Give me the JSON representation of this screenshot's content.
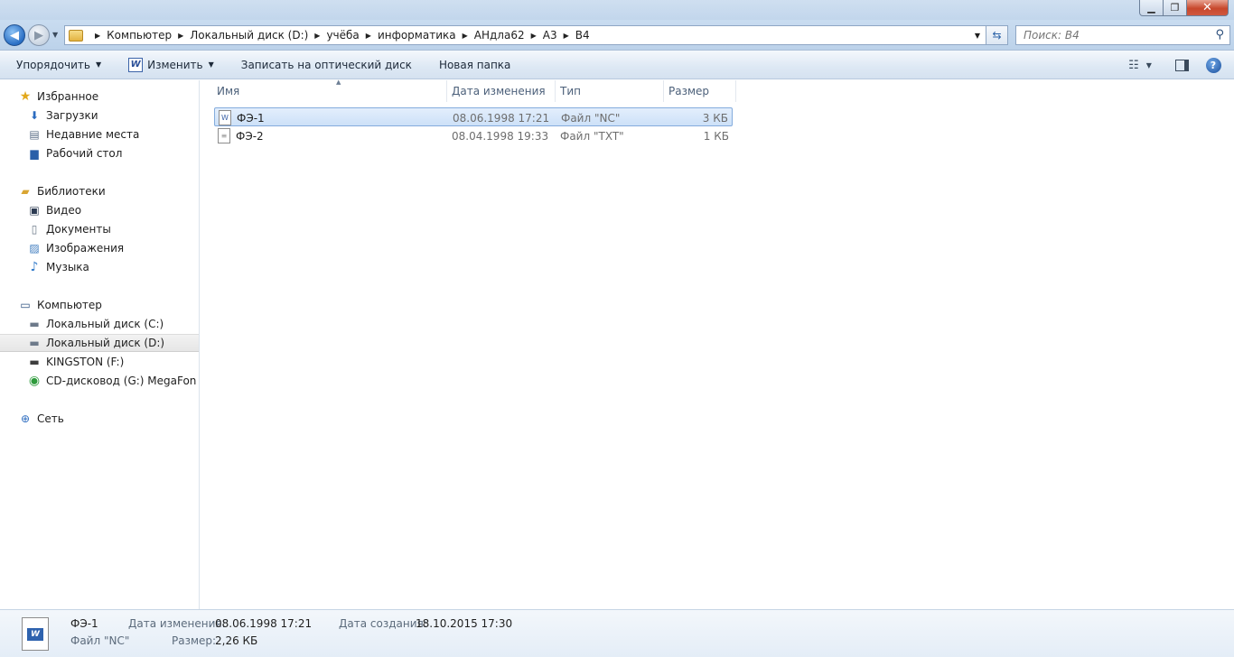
{
  "window": {
    "minimize_glyph": "▁",
    "maximize_glyph": "❐",
    "close_glyph": "✕"
  },
  "address": {
    "crumbs": [
      "Компьютер",
      "Локальный диск (D:)",
      "учёба",
      "информатика",
      "АНдла62",
      "А3",
      "В4"
    ],
    "search_placeholder": "Поиск: В4"
  },
  "toolbar": {
    "organize": "Упорядочить",
    "edit": "Изменить",
    "burn": "Записать на оптический диск",
    "new_folder": "Новая папка"
  },
  "nav": {
    "favorites": "Избранное",
    "downloads": "Загрузки",
    "recent": "Недавние места",
    "desktop": "Рабочий стол",
    "libraries": "Библиотеки",
    "video": "Видео",
    "documents": "Документы",
    "pictures": "Изображения",
    "music": "Музыка",
    "computer": "Компьютер",
    "drive_c": "Локальный диск (C:)",
    "drive_d": "Локальный диск (D:)",
    "drive_f": "KINGSTON (F:)",
    "drive_g": "CD-дисковод (G:) MegaFon Mo",
    "network": "Сеть"
  },
  "columns": {
    "name": "Имя",
    "date": "Дата изменения",
    "type": "Тип",
    "size": "Размер"
  },
  "files": [
    {
      "name": "ФЭ-1",
      "date": "08.06.1998 17:21",
      "type": "Файл \"NC\"",
      "size": "3 КБ"
    },
    {
      "name": "ФЭ-2",
      "date": "08.04.1998 19:33",
      "type": "Файл \"TXT\"",
      "size": "1 КБ"
    }
  ],
  "details": {
    "name": "ФЭ-1",
    "type": "Файл \"NC\"",
    "modified_label": "Дата изменения:",
    "modified_value": "08.06.1998 17:21",
    "created_label": "Дата создания:",
    "created_value": "18.10.2015 17:30",
    "size_label": "Размер:",
    "size_value": "2,26 КБ"
  },
  "colors": {
    "selection_fill": "#cde1f8",
    "selection_border": "#84acdd",
    "chrome": "#c2d6ec"
  },
  "icons": {
    "back": "back-arrow-icon",
    "forward": "forward-arrow-icon",
    "refresh": "refresh-icon",
    "search": "search-icon",
    "help": "help-icon"
  }
}
